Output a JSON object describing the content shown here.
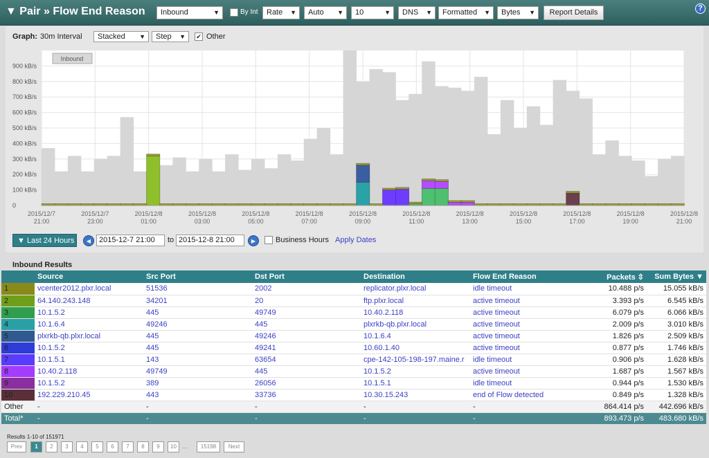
{
  "header": {
    "title": "▼ Pair » Flow End Reason",
    "selects": [
      "Inbound",
      "Rate",
      "Auto",
      "10",
      "DNS",
      "Formatted",
      "Bytes"
    ],
    "by_int_label": "By Int",
    "report_button": "Report Details",
    "help": "?"
  },
  "graph": {
    "label": "Graph:",
    "interval": "30m Interval",
    "mode": "Stacked",
    "style": "Step",
    "other_label": "Other",
    "legend_box": "Inbound"
  },
  "chart_data": {
    "type": "area",
    "ylim": [
      0,
      1000
    ],
    "y_ticks": [
      "0",
      "100 kB/s",
      "200 kB/s",
      "300 kB/s",
      "400 kB/s",
      "500 kB/s",
      "600 kB/s",
      "700 kB/s",
      "800 kB/s",
      "900 kB/s"
    ],
    "x_ticks": [
      "2015/12/7 21:00",
      "2015/12/7 23:00",
      "2015/12/8 01:00",
      "2015/12/8 03:00",
      "2015/12/8 05:00",
      "2015/12/8 07:00",
      "2015/12/8 09:00",
      "2015/12/8 11:00",
      "2015/12/8 13:00",
      "2015/12/8 15:00",
      "2015/12/8 17:00",
      "2015/12/8 19:00",
      "2015/12/8 21:00"
    ],
    "total": [
      370,
      220,
      320,
      220,
      300,
      320,
      570,
      220,
      330,
      260,
      310,
      220,
      300,
      220,
      330,
      230,
      300,
      240,
      330,
      290,
      430,
      500,
      330,
      1000,
      800,
      880,
      860,
      680,
      720,
      930,
      770,
      760,
      740,
      830,
      460,
      680,
      500,
      640,
      520,
      810,
      740,
      690,
      330,
      420,
      320,
      290,
      190,
      300,
      320
    ],
    "series": [
      {
        "color": "#8fbf2a",
        "values": [
          0,
          0,
          0,
          0,
          0,
          0,
          0,
          0,
          320,
          0,
          0,
          0,
          0,
          0,
          0,
          0,
          0,
          0,
          0,
          0,
          0,
          0,
          0,
          0,
          0,
          0,
          0,
          0,
          0,
          0,
          0,
          0,
          0,
          0,
          0,
          0,
          0,
          0,
          0,
          0,
          0,
          0,
          0,
          0,
          0,
          0,
          0,
          0,
          0
        ]
      },
      {
        "color": "#2aa2a6",
        "values": [
          0,
          0,
          0,
          0,
          0,
          0,
          0,
          0,
          0,
          0,
          0,
          0,
          0,
          0,
          0,
          0,
          0,
          0,
          0,
          0,
          0,
          0,
          0,
          0,
          150,
          0,
          0,
          0,
          0,
          0,
          0,
          0,
          0,
          0,
          0,
          0,
          0,
          0,
          0,
          0,
          0,
          0,
          0,
          0,
          0,
          0,
          0,
          0,
          0
        ]
      },
      {
        "color": "#3a5ea0",
        "values": [
          0,
          0,
          0,
          0,
          0,
          0,
          0,
          0,
          0,
          0,
          0,
          0,
          0,
          0,
          0,
          0,
          0,
          0,
          0,
          0,
          0,
          0,
          0,
          0,
          110,
          0,
          0,
          0,
          0,
          0,
          0,
          0,
          0,
          0,
          0,
          0,
          0,
          0,
          0,
          0,
          0,
          0,
          0,
          0,
          0,
          0,
          0,
          0,
          0
        ]
      },
      {
        "color": "#6e3cff",
        "values": [
          0,
          0,
          0,
          0,
          0,
          0,
          0,
          0,
          0,
          0,
          0,
          0,
          0,
          0,
          0,
          0,
          0,
          0,
          0,
          0,
          0,
          0,
          0,
          0,
          0,
          0,
          100,
          105,
          0,
          0,
          0,
          0,
          0,
          0,
          0,
          0,
          0,
          0,
          0,
          0,
          0,
          0,
          0,
          0,
          0,
          0,
          0,
          0,
          0
        ]
      },
      {
        "color": "#4fbf70",
        "values": [
          0,
          0,
          0,
          0,
          0,
          0,
          0,
          0,
          0,
          0,
          0,
          0,
          0,
          0,
          0,
          0,
          0,
          0,
          0,
          0,
          0,
          0,
          0,
          0,
          0,
          0,
          0,
          0,
          10,
          110,
          110,
          0,
          0,
          0,
          0,
          0,
          0,
          0,
          0,
          0,
          0,
          0,
          0,
          0,
          0,
          0,
          0,
          0,
          0
        ]
      },
      {
        "color": "#b44cff",
        "values": [
          0,
          0,
          0,
          0,
          0,
          0,
          0,
          0,
          0,
          0,
          0,
          0,
          0,
          0,
          0,
          0,
          0,
          0,
          0,
          0,
          0,
          0,
          0,
          0,
          0,
          0,
          0,
          0,
          0,
          50,
          45,
          20,
          20,
          0,
          0,
          0,
          0,
          0,
          0,
          0,
          0,
          0,
          0,
          0,
          0,
          0,
          0,
          0,
          0
        ]
      },
      {
        "color": "#6b3f4e",
        "values": [
          0,
          0,
          0,
          0,
          0,
          0,
          0,
          0,
          0,
          0,
          0,
          0,
          0,
          0,
          0,
          0,
          0,
          0,
          0,
          0,
          0,
          0,
          0,
          0,
          0,
          0,
          0,
          0,
          0,
          0,
          0,
          0,
          0,
          0,
          0,
          0,
          0,
          0,
          0,
          0,
          80,
          0,
          0,
          0,
          0,
          0,
          0,
          0,
          0
        ]
      },
      {
        "color": "#9a9a30",
        "values": [
          12,
          12,
          12,
          12,
          12,
          12,
          12,
          12,
          12,
          12,
          12,
          12,
          12,
          12,
          12,
          12,
          12,
          12,
          12,
          12,
          12,
          12,
          12,
          12,
          12,
          12,
          12,
          12,
          12,
          12,
          12,
          12,
          12,
          12,
          12,
          12,
          12,
          12,
          12,
          12,
          12,
          12,
          12,
          12,
          12,
          12,
          12,
          12,
          12
        ]
      }
    ]
  },
  "range": {
    "last24": "▼ Last 24 Hours",
    "from": "2015-12-7 21:00",
    "to_label": "to",
    "to": "2015-12-8 21:00",
    "business_hours": "Business Hours",
    "apply": "Apply Dates"
  },
  "results": {
    "title": "Inbound Results",
    "columns": [
      "Source",
      "Src Port",
      "Dst Port",
      "Destination",
      "Flow End Reason",
      "Packets",
      "Sum Bytes"
    ],
    "rows": [
      {
        "rank": "1",
        "color": "#8a8a1a",
        "source": "vcenter2012.plxr.local",
        "src_port": "51536",
        "dst_port": "2002",
        "destination": "replicator.plxr.local",
        "reason": "idle timeout",
        "packets": "10.488 p/s",
        "bytes": "15.055 kB/s"
      },
      {
        "rank": "2",
        "color": "#6f9f1a",
        "source": "64.140.243.148",
        "src_port": "34201",
        "dst_port": "20",
        "destination": "ftp.plxr.local",
        "reason": "active timeout",
        "packets": "3.393 p/s",
        "bytes": "6.545 kB/s"
      },
      {
        "rank": "3",
        "color": "#2f9f4f",
        "source": "10.1.5.2",
        "src_port": "445",
        "dst_port": "49749",
        "destination": "10.40.2.118",
        "reason": "active timeout",
        "packets": "6.079 p/s",
        "bytes": "6.066 kB/s"
      },
      {
        "rank": "4",
        "color": "#2a9fa6",
        "source": "10.1.6.4",
        "src_port": "49246",
        "dst_port": "445",
        "destination": "plxrkb-qb.plxr.local",
        "reason": "active timeout",
        "packets": "2.009 p/s",
        "bytes": "3.010 kB/s"
      },
      {
        "rank": "5",
        "color": "#2f5a90",
        "source": "plxrkb-qb.plxr.local",
        "src_port": "445",
        "dst_port": "49246",
        "destination": "10.1.6.4",
        "reason": "active timeout",
        "packets": "1.826 p/s",
        "bytes": "2.509 kB/s"
      },
      {
        "rank": "6",
        "color": "#2e3cd8",
        "source": "10.1.5.2",
        "src_port": "445",
        "dst_port": "49241",
        "destination": "10.60.1.40",
        "reason": "active timeout",
        "packets": "0.877 p/s",
        "bytes": "1.746 kB/s"
      },
      {
        "rank": "7",
        "color": "#5a3cff",
        "source": "10.1.5.1",
        "src_port": "143",
        "dst_port": "63654",
        "destination": "cpe-142-105-198-197.maine.r",
        "reason": "idle timeout",
        "packets": "0.906 p/s",
        "bytes": "1.628 kB/s"
      },
      {
        "rank": "8",
        "color": "#a43cff",
        "source": "10.40.2.118",
        "src_port": "49749",
        "dst_port": "445",
        "destination": "10.1.5.2",
        "reason": "active timeout",
        "packets": "1.687 p/s",
        "bytes": "1.567 kB/s"
      },
      {
        "rank": "9",
        "color": "#8a2f9f",
        "source": "10.1.5.2",
        "src_port": "389",
        "dst_port": "26056",
        "destination": "10.1.5.1",
        "reason": "idle timeout",
        "packets": "0.944 p/s",
        "bytes": "1.530 kB/s"
      },
      {
        "rank": "10",
        "color": "#5a2f3a",
        "source": "192.229.210.45",
        "src_port": "443",
        "dst_port": "33736",
        "destination": "10.30.15.243",
        "reason": "end of Flow detected",
        "packets": "0.849 p/s",
        "bytes": "1.328 kB/s"
      }
    ],
    "other": {
      "label": "Other",
      "dash": "-",
      "packets": "864.414 p/s",
      "bytes": "442.696 kB/s"
    },
    "total": {
      "label": "Total*",
      "dash": "-",
      "packets": "893.473 p/s",
      "bytes": "483.680 kB/s"
    }
  },
  "pager": {
    "summary": "Results 1-10 of 151971",
    "prev": "Prev",
    "pages": [
      "1",
      "2",
      "3",
      "4",
      "5",
      "6",
      "7",
      "8",
      "9",
      "10"
    ],
    "ellipsis": "...",
    "last": "15198",
    "next": "Next"
  }
}
